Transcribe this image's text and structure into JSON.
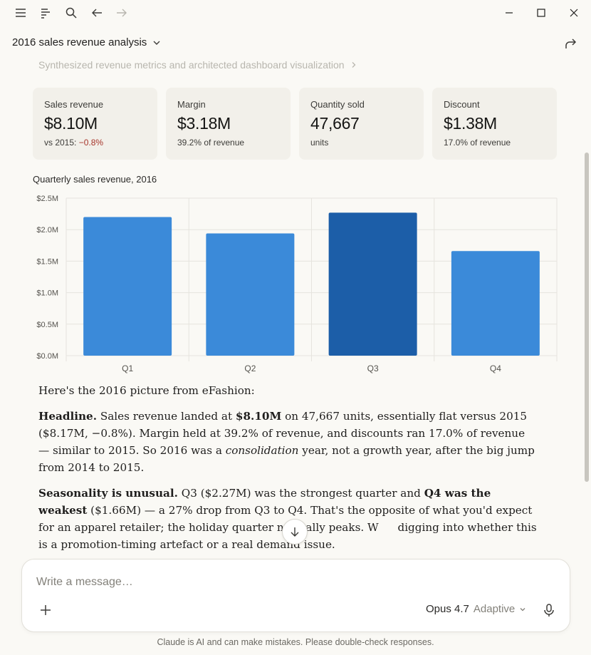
{
  "titlebar": {
    "icons": [
      "menu-icon",
      "sidebar-list-icon",
      "search-icon",
      "back-arrow-icon",
      "forward-arrow-icon",
      "minimize-icon",
      "maximize-icon",
      "close-icon"
    ]
  },
  "conversation": {
    "title": "2016 sales revenue analysis"
  },
  "thinking": {
    "label": "Synthesized revenue metrics and architected dashboard visualization"
  },
  "cards": [
    {
      "label": "Sales revenue",
      "value": "$8.10M",
      "sub_prefix": "vs 2015: ",
      "sub_highlight": "−0.8%"
    },
    {
      "label": "Margin",
      "value": "$3.18M",
      "sub": "39.2% of revenue"
    },
    {
      "label": "Quantity sold",
      "value": "47,667",
      "sub": "units"
    },
    {
      "label": "Discount",
      "value": "$1.38M",
      "sub": "17.0% of revenue"
    }
  ],
  "chart_data": {
    "type": "bar",
    "title": "Quarterly sales revenue, 2016",
    "categories": [
      "Q1",
      "Q2",
      "Q3",
      "Q4"
    ],
    "values": [
      2.2,
      1.94,
      2.27,
      1.66
    ],
    "highlight_index": 2,
    "ylim": [
      0,
      2.5
    ],
    "yticks": [
      "$0.0M",
      "$0.5M",
      "$1.0M",
      "$1.5M",
      "$2.0M",
      "$2.5M"
    ],
    "grid": true,
    "colors": {
      "bar": "#3b8ad9",
      "highlight": "#1c5ea8",
      "grid": "#e6e4de",
      "tick_text": "#55534e"
    }
  },
  "message": {
    "intro": "Here's the 2016 picture from eFashion:",
    "p1": {
      "lead": "Headline.",
      "t1": " Sales revenue landed at ",
      "b1": "$8.10M",
      "t2": " on 47,667 units, essentially flat versus 2015 ($8.17M, −0.8%). Margin held at 39.2% of revenue, and discounts ran 17.0% of revenue — similar to 2015. So 2016 was a ",
      "em": "consolidation",
      "t3": " year, not a growth year, after the big jump from 2014 to 2015."
    },
    "p2": {
      "lead": "Seasonality is unusual.",
      "t1": " Q3 ($2.27M) was the strongest quarter and ",
      "b1": "Q4 was the weakest",
      "t2": " ($1.66M) — a 27% drop from Q3 to Q4. That's the opposite of what you'd expect for an apparel retailer; the holiday quarter normally peaks. W",
      "t3": " digging into whether this is a promotion-timing artefact or a real demand issue."
    }
  },
  "composer": {
    "placeholder": "Write a message…",
    "model": "Opus 4.7",
    "mode": "Adaptive"
  },
  "footer": {
    "disclaimer": "Claude is AI and can make mistakes. Please double-check responses."
  }
}
